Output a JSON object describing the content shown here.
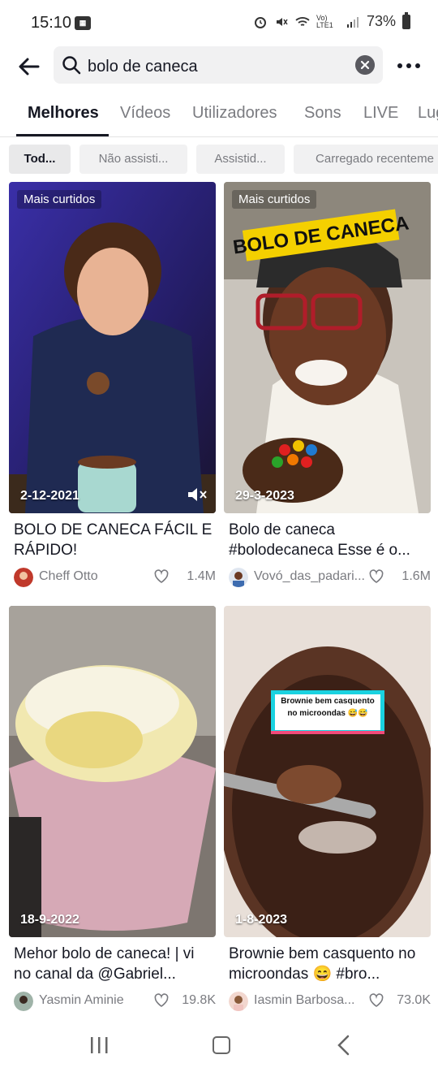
{
  "status_bar": {
    "time": "15:10",
    "battery": "73%",
    "network": "Vo) LTE1"
  },
  "search": {
    "query": "bolo de caneca"
  },
  "tabs": [
    {
      "label": "Melhores"
    },
    {
      "label": "Vídeos"
    },
    {
      "label": "Utilizadores"
    },
    {
      "label": "Sons"
    },
    {
      "label": "LIVE"
    },
    {
      "label": "Lug"
    }
  ],
  "chips": [
    {
      "label": "Tod..."
    },
    {
      "label": "Não assisti..."
    },
    {
      "label": "Assistid..."
    },
    {
      "label": "Carregado recenteme"
    }
  ],
  "results": [
    {
      "badge": "Mais curtidos",
      "date": "2-12-2021",
      "title": "BOLO DE CANECA FÁCIL E RÁPIDO!",
      "author": "Cheff Otto",
      "likes": "1.4M",
      "overlay_text": ""
    },
    {
      "badge": "Mais curtidos",
      "date": "29-3-2023",
      "title": "Bolo de caneca #bolodecaneca Esse é o...",
      "author": "Vovó_das_padari...",
      "likes": "1.6M",
      "overlay_text": "BOLO DE CANECA"
    },
    {
      "badge": "",
      "date": "18-9-2022",
      "title": "Mehor bolo de caneca! | vi no canal da @Gabriel...",
      "author": "Yasmin Aminie",
      "likes": "19.8K",
      "overlay_text": ""
    },
    {
      "badge": "",
      "date": "1-8-2023",
      "title": "Brownie bem casquento no microondas 😄 #bro...",
      "author": "Iasmin Barbosa...",
      "likes": "73.0K",
      "overlay_text": "Brownie bem casquento no microondas 😅😅"
    }
  ],
  "colors": {
    "text_primary": "#161823",
    "text_secondary": "#7a7b80",
    "chip_bg": "#f1f1f2"
  }
}
